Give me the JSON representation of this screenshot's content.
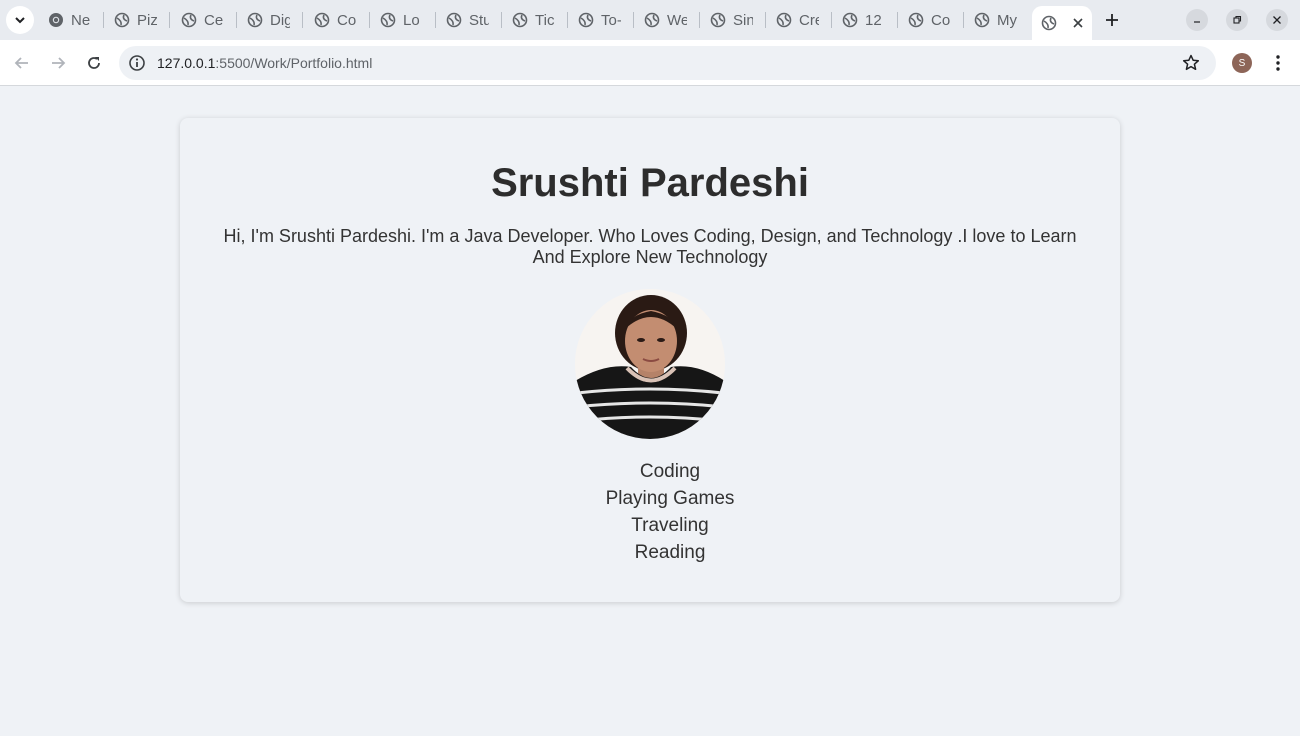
{
  "browser": {
    "tabs": [
      {
        "title": "Ne",
        "icon": "chrome-icon"
      },
      {
        "title": "Piz",
        "icon": "globe-icon"
      },
      {
        "title": "Cer",
        "icon": "globe-icon"
      },
      {
        "title": "Dig",
        "icon": "globe-icon"
      },
      {
        "title": "Co",
        "icon": "globe-icon"
      },
      {
        "title": "Lo",
        "icon": "globe-icon"
      },
      {
        "title": "Stu",
        "icon": "globe-icon"
      },
      {
        "title": "Tic",
        "icon": "globe-icon"
      },
      {
        "title": "To-",
        "icon": "globe-icon"
      },
      {
        "title": "We",
        "icon": "globe-icon"
      },
      {
        "title": "Sin",
        "icon": "globe-icon"
      },
      {
        "title": "Cre",
        "icon": "globe-icon"
      },
      {
        "title": "12",
        "icon": "globe-icon"
      },
      {
        "title": "Co",
        "icon": "globe-icon"
      },
      {
        "title": "My",
        "icon": "globe-icon"
      }
    ],
    "url_host": "127.0.0.1",
    "url_path": ":5500/Work/Portfolio.html",
    "profile_initial": "S"
  },
  "page": {
    "name": "Srushti Pardeshi",
    "bio": "Hi, I'm Srushti Pardeshi. I'm a Java Developer. Who Loves Coding, Design, and Technology .I love to Learn And Explore New Technology",
    "hobbies": [
      "Coding",
      "Playing Games",
      "Traveling",
      "Reading"
    ]
  },
  "colors": {
    "page_bg": "#eff2f6",
    "heading": "#2d2d2d",
    "text": "#333333"
  }
}
